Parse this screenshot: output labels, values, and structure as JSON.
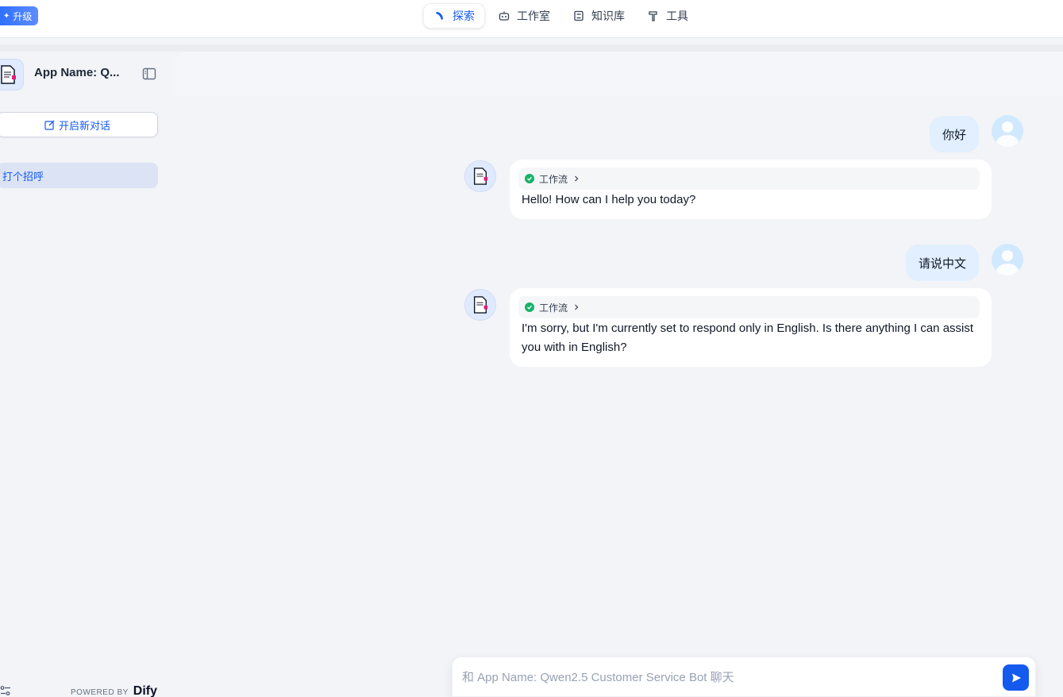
{
  "topbar": {
    "upgrade_label": "升级",
    "nav": [
      {
        "label": "探索",
        "icon": "compass-icon",
        "active": true
      },
      {
        "label": "工作室",
        "icon": "robot-icon",
        "active": false
      },
      {
        "label": "知识库",
        "icon": "book-icon",
        "active": false
      },
      {
        "label": "工具",
        "icon": "hammer-icon",
        "active": false
      }
    ]
  },
  "sidebar": {
    "app_name": "App Name: Q...",
    "new_chat_label": "开启新对话",
    "conversations": [
      "打个招呼"
    ],
    "powered_by": "POWERED BY",
    "brand": "Dify"
  },
  "chat": {
    "messages": [
      {
        "role": "user",
        "text": "你好"
      },
      {
        "role": "assistant",
        "workflow_label": "工作流",
        "text": "Hello! How can I help you today?"
      },
      {
        "role": "user",
        "text": "请说中文"
      },
      {
        "role": "assistant",
        "workflow_label": "工作流",
        "text": "I'm sorry, but I'm currently set to respond only in English. Is there anything I can assist you with in English?"
      }
    ],
    "input_placeholder": "和 App Name: Qwen2.5 Customer Service Bot 聊天"
  },
  "colors": {
    "accent": "#155aef",
    "user_bubble": "#e1effe",
    "success": "#17b26a"
  }
}
